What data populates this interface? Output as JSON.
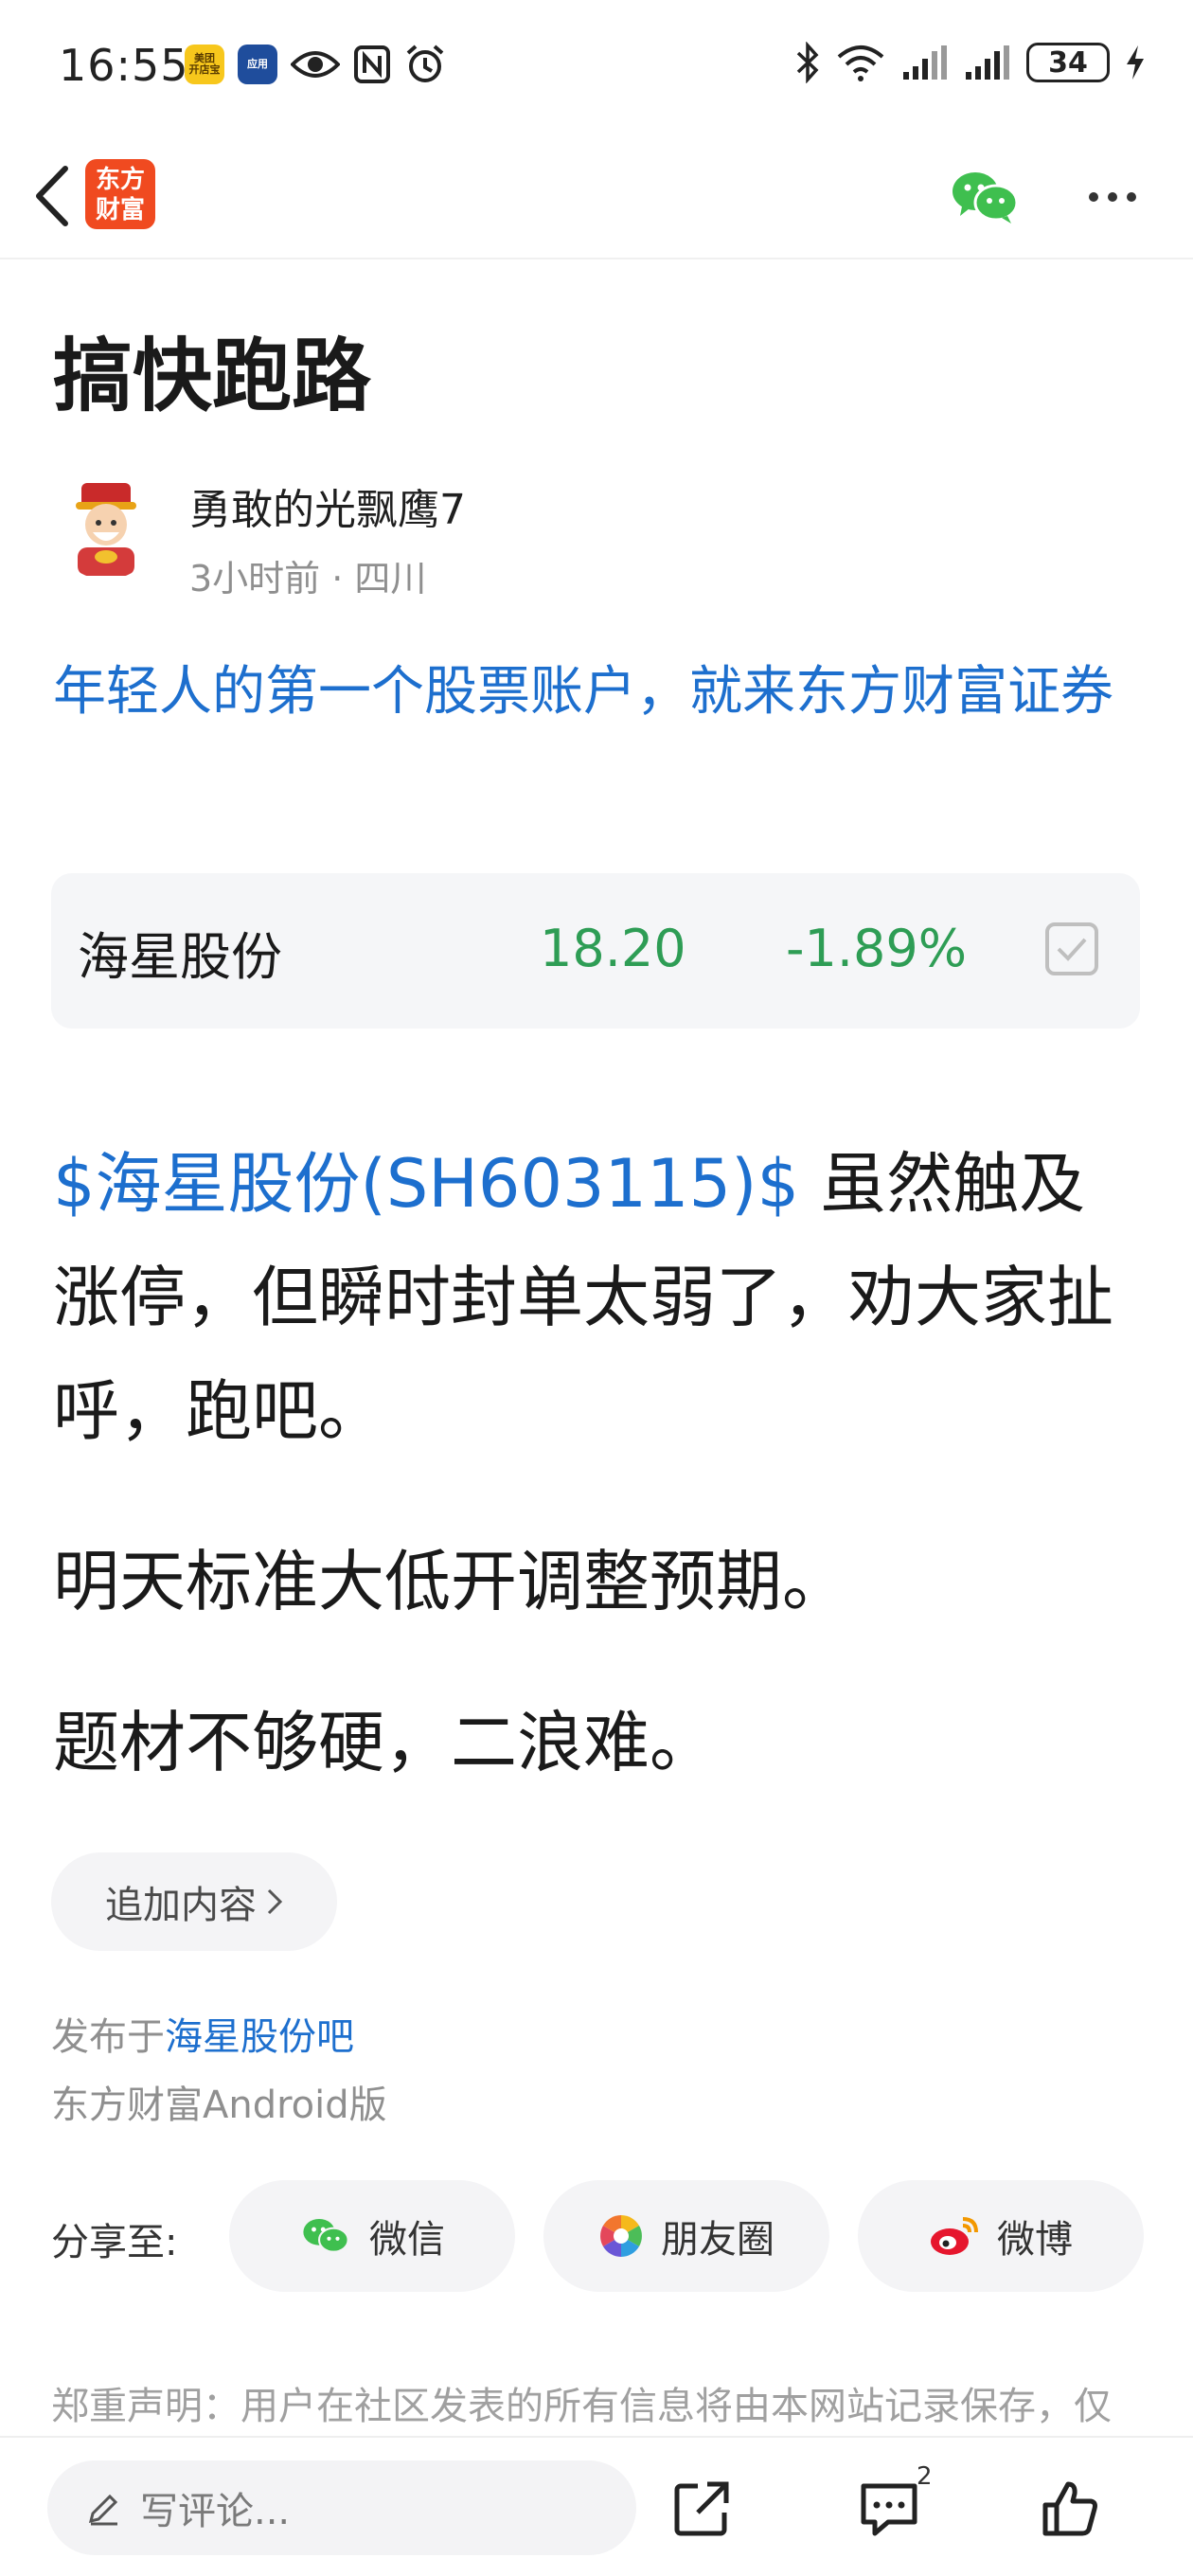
{
  "status_bar": {
    "time": "16:55",
    "left_app_1": "美团\n开店宝",
    "left_app_2": "应用",
    "battery": "34"
  },
  "header": {
    "logo_text": "东方\n财富"
  },
  "article": {
    "title": "搞快跑路",
    "author": "勇敢的光飘鹰7",
    "meta": "3小时前 · 四川",
    "promo": "年轻人的第一个股票账户，就来东方财富证券",
    "stock_card": {
      "name": "海星股份",
      "price": "18.20",
      "change": "-1.89%",
      "color": "#2e9d55"
    },
    "p1_tag": "$海星股份(SH603115)$",
    "p1_text": " 虽然触及涨停，但瞬时封单太弱了，劝大家扯呼，跑吧。",
    "p2": "明天标准大低开调整预期。",
    "p3": "题材不够硬，二浪难。",
    "add_content": "追加内容",
    "published_prefix": "发布于",
    "published_forum": "海星股份吧",
    "client": "东方财富Android版"
  },
  "share": {
    "label": "分享至:",
    "wechat": "微信",
    "moments": "朋友圈",
    "weibo": "微博"
  },
  "disclaimer": "郑重声明：用户在社区发表的所有信息将由本网站记录保存，仅",
  "bottom_bar": {
    "comment_placeholder": "写评论...",
    "comment_count": "2"
  },
  "colors": {
    "link": "#1d6fce",
    "down": "#2e9d55",
    "brand": "#f04a20"
  }
}
